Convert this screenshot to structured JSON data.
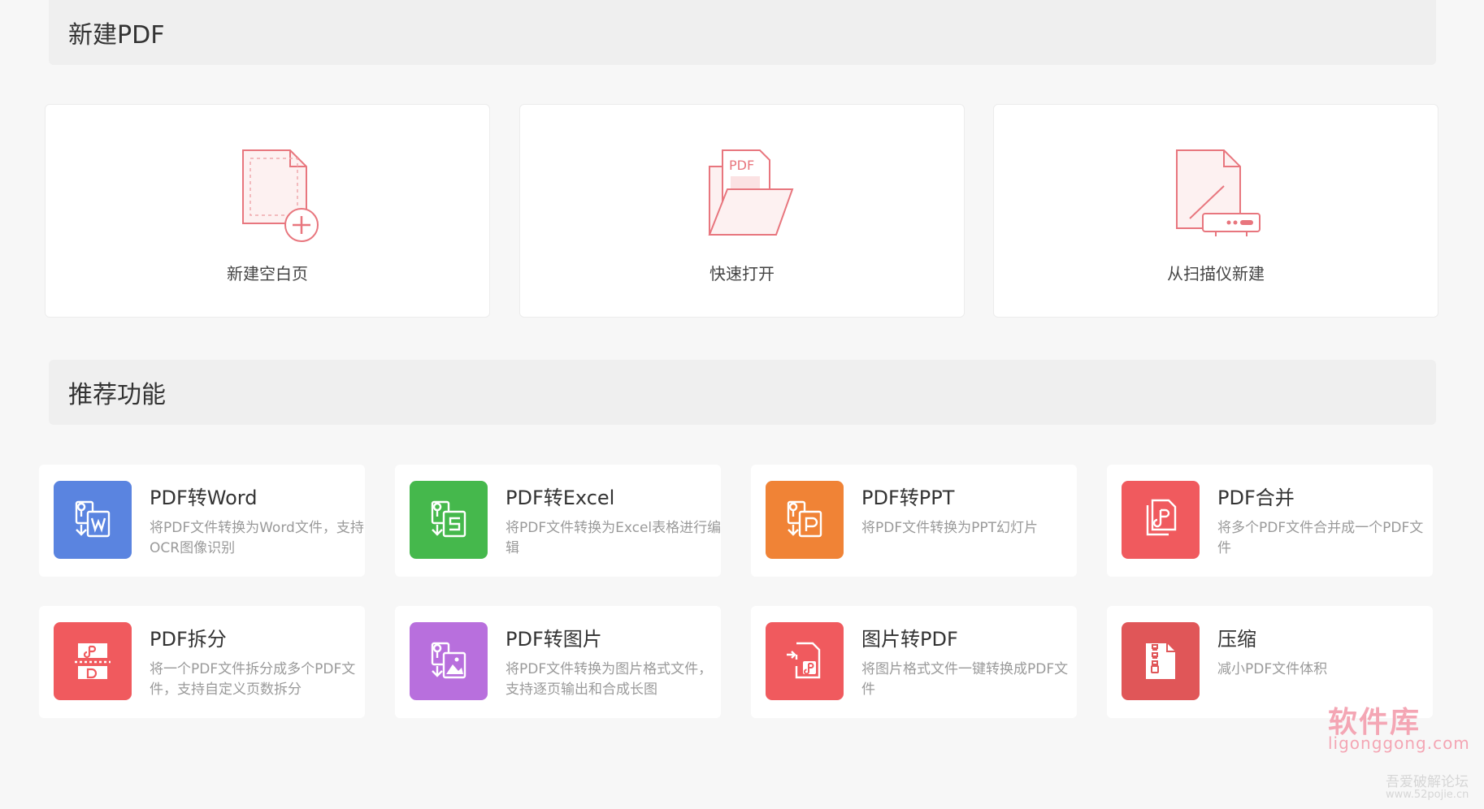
{
  "sections": {
    "new_pdf": "新建PDF",
    "recommended": "推荐功能"
  },
  "create_cards": [
    {
      "label": "新建空白页",
      "icon": "blank-page-plus-icon"
    },
    {
      "label": "快速打开",
      "icon": "open-folder-pdf-icon",
      "badge": "PDF"
    },
    {
      "label": "从扫描仪新建",
      "icon": "scanner-icon"
    }
  ],
  "features": [
    {
      "title": "PDF转Word",
      "desc": "将PDF文件转换为Word文件，支持OCR图像识别",
      "color": "#5a84e0",
      "icon": "pdf-to-word-icon"
    },
    {
      "title": "PDF转Excel",
      "desc": "将PDF文件转换为Excel表格进行编辑",
      "color": "#45b84c",
      "icon": "pdf-to-excel-icon"
    },
    {
      "title": "PDF转PPT",
      "desc": "将PDF文件转换为PPT幻灯片",
      "color": "#f08336",
      "icon": "pdf-to-ppt-icon"
    },
    {
      "title": "PDF合并",
      "desc": "将多个PDF文件合并成一个PDF文件",
      "color": "#f05a5e",
      "icon": "pdf-merge-icon"
    },
    {
      "title": "PDF拆分",
      "desc": "将一个PDF文件拆分成多个PDF文件，支持自定义页数拆分",
      "color": "#f05a5e",
      "icon": "pdf-split-icon"
    },
    {
      "title": "PDF转图片",
      "desc": "将PDF文件转换为图片格式文件，支持逐页输出和合成长图",
      "color": "#b86fdd",
      "icon": "pdf-to-image-icon"
    },
    {
      "title": "图片转PDF",
      "desc": "将图片格式文件一键转换成PDF文件",
      "color": "#f05a5e",
      "icon": "image-to-pdf-icon"
    },
    {
      "title": "压缩",
      "desc": "减小PDF文件体积",
      "color": "#e05658",
      "icon": "compress-icon"
    }
  ],
  "watermark": {
    "brand": "软件库",
    "domain": "ligonggong.com",
    "forum": "吾爱破解论坛",
    "forum_url": "www.52pojie.cn"
  },
  "colors": {
    "illustration_stroke": "#e8767e",
    "illustration_fill": "#fdeeee"
  }
}
